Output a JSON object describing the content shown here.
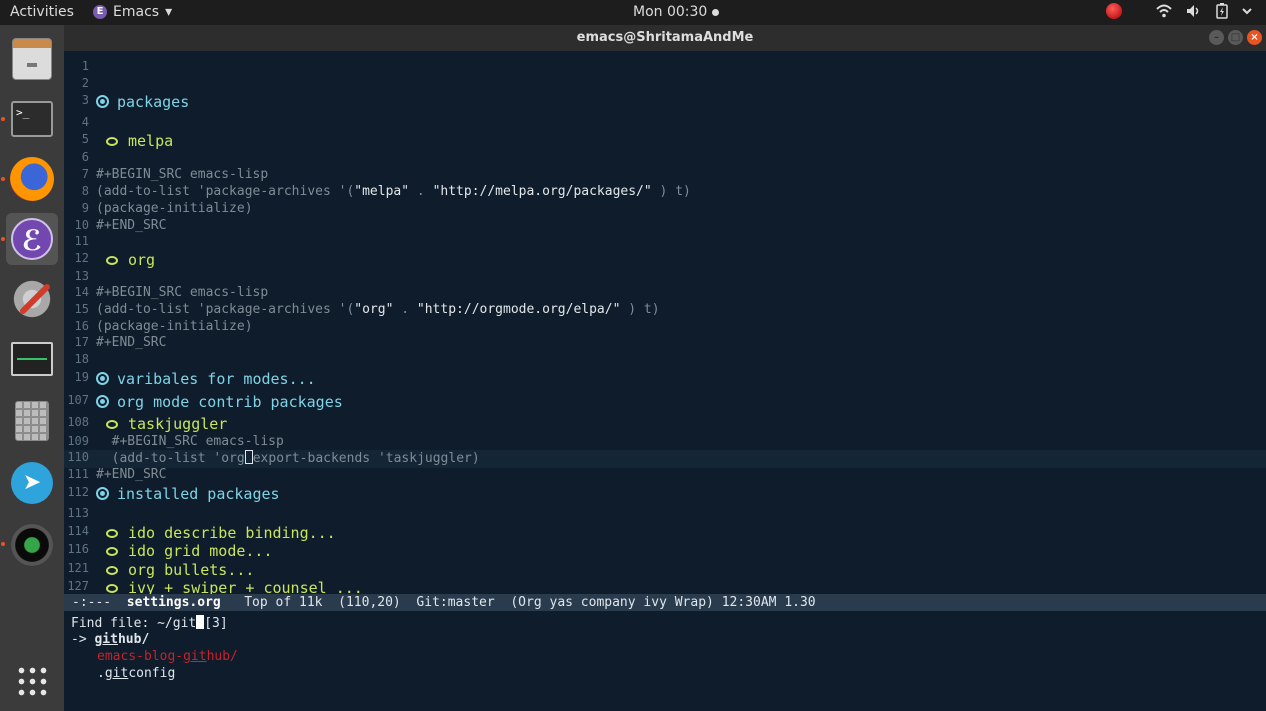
{
  "topbar": {
    "activities": "Activities",
    "app_name": "Emacs",
    "app_menu_arrow": "▾",
    "clock": "Mon 00:30",
    "tray_icons": [
      "record-indicator",
      "wifi-icon",
      "volume-icon",
      "battery-icon",
      "menu-arrow-icon"
    ]
  },
  "dock": {
    "items": [
      "files",
      "terminal",
      "firefox",
      "emacs",
      "settings",
      "system-monitor",
      "calculator",
      "telegram",
      "camera",
      "show-apps"
    ]
  },
  "window": {
    "title": "emacs@ShritamaAndMe",
    "controls": [
      "minimize",
      "maximize",
      "close"
    ]
  },
  "editor": {
    "lines": [
      {
        "n": "1"
      },
      {
        "n": "2"
      },
      {
        "n": "3",
        "h1": "packages"
      },
      {
        "n": "4"
      },
      {
        "n": "5",
        "h2": "melpa"
      },
      {
        "n": "6"
      },
      {
        "n": "7",
        "code": "#+BEGIN_SRC emacs-lisp"
      },
      {
        "n": "8",
        "code_pre": "(add-to-list 'package-archives '(",
        "s1": "\"melpa\"",
        "code_mid": " . ",
        "s2": "\"http://melpa.org/packages/\"",
        "code_post": " ) t)"
      },
      {
        "n": "9",
        "code": "(package-initialize)"
      },
      {
        "n": "10",
        "code": "#+END_SRC"
      },
      {
        "n": "11"
      },
      {
        "n": "12",
        "h2": "org"
      },
      {
        "n": "13"
      },
      {
        "n": "14",
        "code": "#+BEGIN_SRC emacs-lisp"
      },
      {
        "n": "15",
        "code_pre": "(add-to-list 'package-archives '(",
        "s1": "\"org\"",
        "code_mid": " . ",
        "s2": "\"http://orgmode.org/elpa/\"",
        "code_post": " ) t)"
      },
      {
        "n": "16",
        "code": "(package-initialize)"
      },
      {
        "n": "17",
        "code": "#+END_SRC"
      },
      {
        "n": "18"
      },
      {
        "n": "19",
        "h1": "varibales for modes..."
      },
      {
        "n": "107",
        "h1": "org mode contrib packages"
      },
      {
        "n": "108",
        "h2": "taskjuggler"
      },
      {
        "n": "109",
        "code": "  #+BEGIN_SRC emacs-lisp"
      },
      {
        "n": "110",
        "code_a": "  (add-to-list 'org",
        "code_b": "export-backends 'taskjuggler)",
        "current": true
      },
      {
        "n": "111",
        "code": "#+END_SRC"
      },
      {
        "n": "112",
        "h1": "installed packages"
      },
      {
        "n": "113"
      },
      {
        "n": "114",
        "h2": "ido describe binding..."
      },
      {
        "n": "116",
        "h2": "ido grid mode..."
      },
      {
        "n": "121",
        "h2": "org bullets..."
      },
      {
        "n": "127",
        "h2": "ivy + swiper + counsel ..."
      }
    ]
  },
  "modeline": {
    "state": "-:---",
    "buffer": "settings.org",
    "position": "Top of 11k",
    "cursor": "(110,20)",
    "vc": "Git:master",
    "modes": "(Org yas company ivy Wrap)",
    "time": "12:30AM",
    "load": "1.30"
  },
  "minibuffer": {
    "prompt": "Find file: ~/git",
    "count": "[3]",
    "selected_prefix": "-> ",
    "candidates": [
      {
        "pre": "",
        "match": "git",
        "post": "hub/"
      },
      {
        "pre": "emacs-blog-",
        "match": "git",
        "post": "hub/"
      },
      {
        "pre": ".",
        "match": "git",
        "post": "config"
      }
    ]
  }
}
